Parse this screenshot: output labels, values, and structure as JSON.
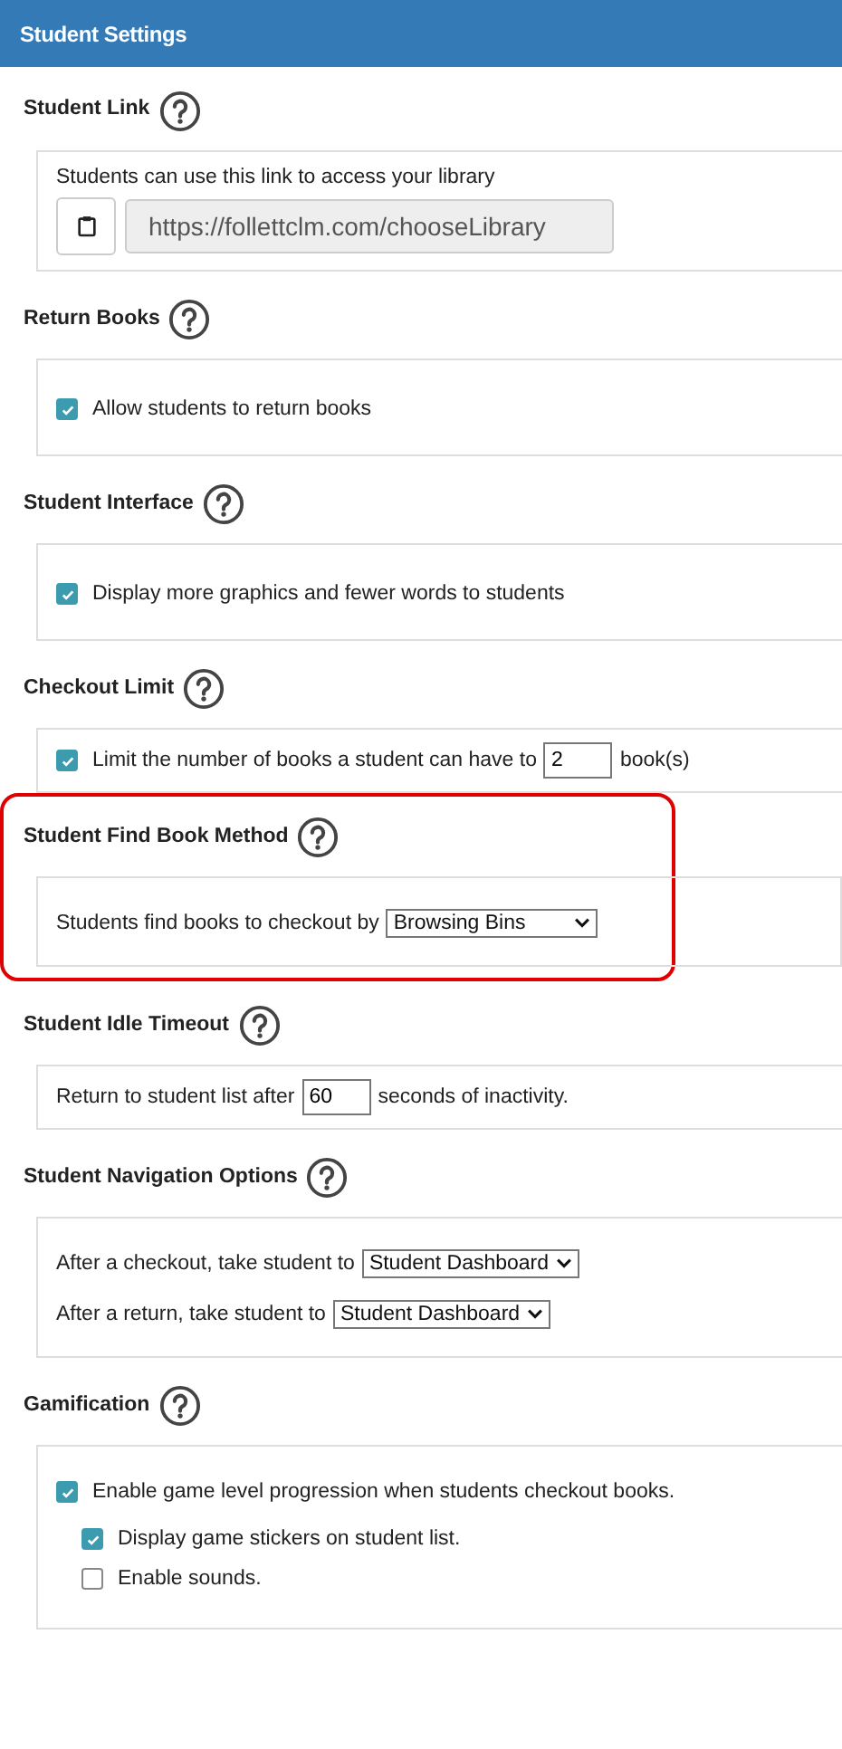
{
  "header": {
    "title": "Student Settings"
  },
  "sections": [
    {
      "title": "Student Link",
      "rows": [
        {
          "kind": "text",
          "text": "Students can use this link to access your library"
        },
        {
          "kind": "link",
          "value": "https://follettclm.com/chooseLibrary"
        }
      ]
    },
    {
      "title": "Return Books",
      "rows": [
        {
          "kind": "checkbox",
          "label": "Allow students to return books",
          "checked": true
        }
      ]
    },
    {
      "title": "Student Interface",
      "rows": [
        {
          "kind": "checkbox",
          "label": "Display more graphics and fewer words to students",
          "checked": true
        }
      ]
    },
    {
      "title": "Checkout Limit",
      "rows": [
        {
          "kind": "inline",
          "checked": true,
          "parts": [
            {
              "kind": "text",
              "text": "Limit the number of books a student can have to"
            },
            {
              "kind": "input",
              "value": "2"
            },
            {
              "kind": "text",
              "text": "book(s)"
            }
          ]
        }
      ]
    },
    {
      "title": "Student Find Book Method",
      "highlighted": true,
      "rows": [
        {
          "kind": "inline",
          "parts": [
            {
              "kind": "text",
              "text": "Students find books to checkout by"
            },
            {
              "kind": "select",
              "value": "Browsing Bins"
            }
          ]
        }
      ]
    },
    {
      "title": "Student Idle Timeout",
      "rows": [
        {
          "kind": "inline",
          "parts": [
            {
              "kind": "text",
              "text": "Return to student list after"
            },
            {
              "kind": "input",
              "value": "60"
            },
            {
              "kind": "text",
              "text": "seconds of inactivity."
            }
          ]
        }
      ]
    },
    {
      "title": "Student Navigation Options",
      "rows": [
        {
          "kind": "inline",
          "parts": [
            {
              "kind": "text",
              "text": "After a checkout, take student to"
            },
            {
              "kind": "select",
              "value": "Student Dashboard"
            }
          ]
        },
        {
          "kind": "inline",
          "parts": [
            {
              "kind": "text",
              "text": "After a return, take student to"
            },
            {
              "kind": "select",
              "value": "Student Dashboard"
            }
          ]
        }
      ]
    },
    {
      "title": "Gamification",
      "rows": [
        {
          "kind": "checkbox",
          "label": "Enable game level progression when students checkout books.",
          "checked": true,
          "children": [
            {
              "kind": "checkbox",
              "label": "Display game stickers on student list.",
              "checked": true
            },
            {
              "kind": "checkbox",
              "label": "Enable sounds.",
              "checked": false
            }
          ]
        }
      ]
    }
  ]
}
